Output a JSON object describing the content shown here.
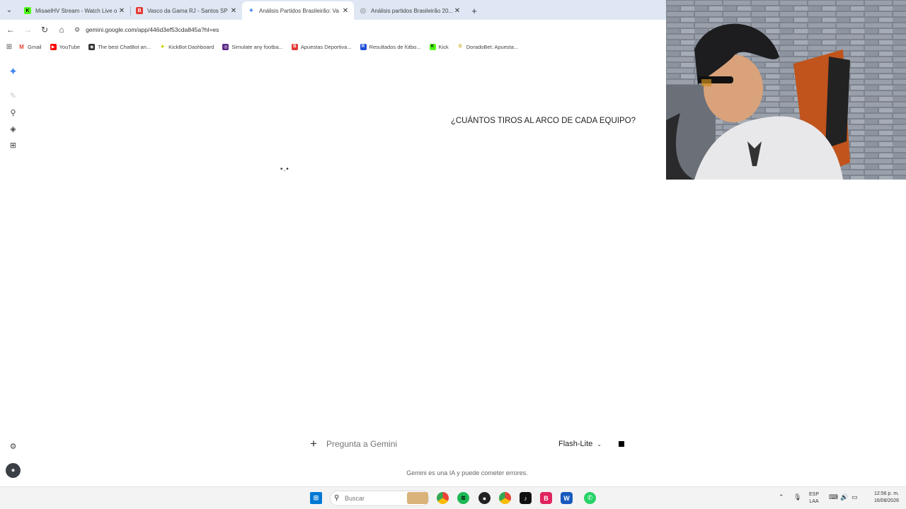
{
  "browser": {
    "tabs": [
      {
        "title": "MisaelHV Stream - Watch Live o",
        "active": false,
        "favicon": "kick-icon",
        "fav_color": "#53fc18",
        "fav_glyph": "K"
      },
      {
        "title": "Vasco da Gama RJ - Santos SP P",
        "active": false,
        "favicon": "betting-site-icon",
        "fav_color": "#e53935",
        "fav_glyph": "B"
      },
      {
        "title": "Análisis Partidos Brasileirão: Va",
        "active": true,
        "favicon": "gemini-icon",
        "fav_color": "#4285f4",
        "fav_glyph": "✦"
      },
      {
        "title": "Análisis partidos Brasileirão 20...",
        "active": false,
        "favicon": "chatgpt-icon",
        "fav_color": "#777777",
        "fav_glyph": "◎"
      }
    ],
    "url": "gemini.google.com/app/446d3ef53cda845a?hl=es",
    "bookmarks": [
      {
        "label": "Gmail",
        "icon": "gmail-icon",
        "color": "#ea4335",
        "glyph": "M"
      },
      {
        "label": "YouTube",
        "icon": "youtube-icon",
        "color": "#ff0000",
        "glyph": "▶"
      },
      {
        "label": "The best ChatBot an...",
        "icon": "chatbot-icon",
        "color": "#333333",
        "glyph": "◉"
      },
      {
        "label": "KickBot Dashboard",
        "icon": "kickbot-icon",
        "color": "#d7e600",
        "glyph": "✦"
      },
      {
        "label": "Simulate any footba...",
        "icon": "simulator-icon",
        "color": "#5b2a86",
        "glyph": "◎"
      },
      {
        "label": "Apuestas Deportiva...",
        "icon": "betting-site-icon",
        "color": "#e53935",
        "glyph": "B"
      },
      {
        "label": "Resultados de fútbo...",
        "icon": "results-icon",
        "color": "#1e4fd8",
        "glyph": "R"
      },
      {
        "label": "Kick",
        "icon": "kick-icon",
        "color": "#53fc18",
        "glyph": "K"
      },
      {
        "label": "DoradoBet: Apuesta...",
        "icon": "doradobet-icon",
        "color": "#c9a400",
        "glyph": "D"
      }
    ]
  },
  "gemini": {
    "user_question": "¿CUÁNTOS TIROS AL ARCO DE CADA EQUIPO?",
    "loading_indicator": "•.•",
    "prompt_placeholder": "Pregunta a Gemini",
    "model_label": "Flash-Lite",
    "disclaimer": "Gemini es una IA y puede cometer errores."
  },
  "taskbar": {
    "search_placeholder": "Buscar",
    "language_top": "ESP",
    "language_bottom": "LAA",
    "time": "12:56 p. m.",
    "date": "16/08/2026"
  },
  "colors": {
    "tabstrip_bg": "#dfe7f4",
    "gemini_blue": "#4285f4"
  }
}
